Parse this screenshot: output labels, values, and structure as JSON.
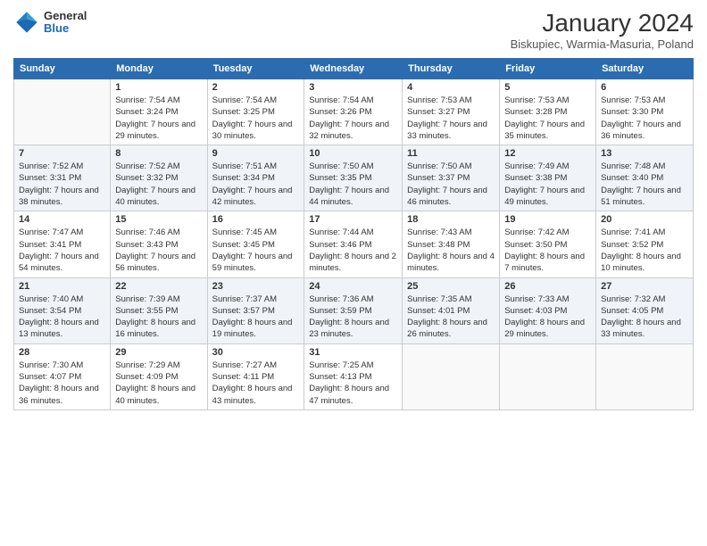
{
  "header": {
    "logo_general": "General",
    "logo_blue": "Blue",
    "title": "January 2024",
    "subtitle": "Biskupiec, Warmia-Masuria, Poland"
  },
  "weekdays": [
    "Sunday",
    "Monday",
    "Tuesday",
    "Wednesday",
    "Thursday",
    "Friday",
    "Saturday"
  ],
  "weeks": [
    [
      {
        "day": "",
        "sunrise": "",
        "sunset": "",
        "daylight": ""
      },
      {
        "day": "1",
        "sunrise": "Sunrise: 7:54 AM",
        "sunset": "Sunset: 3:24 PM",
        "daylight": "Daylight: 7 hours and 29 minutes."
      },
      {
        "day": "2",
        "sunrise": "Sunrise: 7:54 AM",
        "sunset": "Sunset: 3:25 PM",
        "daylight": "Daylight: 7 hours and 30 minutes."
      },
      {
        "day": "3",
        "sunrise": "Sunrise: 7:54 AM",
        "sunset": "Sunset: 3:26 PM",
        "daylight": "Daylight: 7 hours and 32 minutes."
      },
      {
        "day": "4",
        "sunrise": "Sunrise: 7:53 AM",
        "sunset": "Sunset: 3:27 PM",
        "daylight": "Daylight: 7 hours and 33 minutes."
      },
      {
        "day": "5",
        "sunrise": "Sunrise: 7:53 AM",
        "sunset": "Sunset: 3:28 PM",
        "daylight": "Daylight: 7 hours and 35 minutes."
      },
      {
        "day": "6",
        "sunrise": "Sunrise: 7:53 AM",
        "sunset": "Sunset: 3:30 PM",
        "daylight": "Daylight: 7 hours and 36 minutes."
      }
    ],
    [
      {
        "day": "7",
        "sunrise": "Sunrise: 7:52 AM",
        "sunset": "Sunset: 3:31 PM",
        "daylight": "Daylight: 7 hours and 38 minutes."
      },
      {
        "day": "8",
        "sunrise": "Sunrise: 7:52 AM",
        "sunset": "Sunset: 3:32 PM",
        "daylight": "Daylight: 7 hours and 40 minutes."
      },
      {
        "day": "9",
        "sunrise": "Sunrise: 7:51 AM",
        "sunset": "Sunset: 3:34 PM",
        "daylight": "Daylight: 7 hours and 42 minutes."
      },
      {
        "day": "10",
        "sunrise": "Sunrise: 7:50 AM",
        "sunset": "Sunset: 3:35 PM",
        "daylight": "Daylight: 7 hours and 44 minutes."
      },
      {
        "day": "11",
        "sunrise": "Sunrise: 7:50 AM",
        "sunset": "Sunset: 3:37 PM",
        "daylight": "Daylight: 7 hours and 46 minutes."
      },
      {
        "day": "12",
        "sunrise": "Sunrise: 7:49 AM",
        "sunset": "Sunset: 3:38 PM",
        "daylight": "Daylight: 7 hours and 49 minutes."
      },
      {
        "day": "13",
        "sunrise": "Sunrise: 7:48 AM",
        "sunset": "Sunset: 3:40 PM",
        "daylight": "Daylight: 7 hours and 51 minutes."
      }
    ],
    [
      {
        "day": "14",
        "sunrise": "Sunrise: 7:47 AM",
        "sunset": "Sunset: 3:41 PM",
        "daylight": "Daylight: 7 hours and 54 minutes."
      },
      {
        "day": "15",
        "sunrise": "Sunrise: 7:46 AM",
        "sunset": "Sunset: 3:43 PM",
        "daylight": "Daylight: 7 hours and 56 minutes."
      },
      {
        "day": "16",
        "sunrise": "Sunrise: 7:45 AM",
        "sunset": "Sunset: 3:45 PM",
        "daylight": "Daylight: 7 hours and 59 minutes."
      },
      {
        "day": "17",
        "sunrise": "Sunrise: 7:44 AM",
        "sunset": "Sunset: 3:46 PM",
        "daylight": "Daylight: 8 hours and 2 minutes."
      },
      {
        "day": "18",
        "sunrise": "Sunrise: 7:43 AM",
        "sunset": "Sunset: 3:48 PM",
        "daylight": "Daylight: 8 hours and 4 minutes."
      },
      {
        "day": "19",
        "sunrise": "Sunrise: 7:42 AM",
        "sunset": "Sunset: 3:50 PM",
        "daylight": "Daylight: 8 hours and 7 minutes."
      },
      {
        "day": "20",
        "sunrise": "Sunrise: 7:41 AM",
        "sunset": "Sunset: 3:52 PM",
        "daylight": "Daylight: 8 hours and 10 minutes."
      }
    ],
    [
      {
        "day": "21",
        "sunrise": "Sunrise: 7:40 AM",
        "sunset": "Sunset: 3:54 PM",
        "daylight": "Daylight: 8 hours and 13 minutes."
      },
      {
        "day": "22",
        "sunrise": "Sunrise: 7:39 AM",
        "sunset": "Sunset: 3:55 PM",
        "daylight": "Daylight: 8 hours and 16 minutes."
      },
      {
        "day": "23",
        "sunrise": "Sunrise: 7:37 AM",
        "sunset": "Sunset: 3:57 PM",
        "daylight": "Daylight: 8 hours and 19 minutes."
      },
      {
        "day": "24",
        "sunrise": "Sunrise: 7:36 AM",
        "sunset": "Sunset: 3:59 PM",
        "daylight": "Daylight: 8 hours and 23 minutes."
      },
      {
        "day": "25",
        "sunrise": "Sunrise: 7:35 AM",
        "sunset": "Sunset: 4:01 PM",
        "daylight": "Daylight: 8 hours and 26 minutes."
      },
      {
        "day": "26",
        "sunrise": "Sunrise: 7:33 AM",
        "sunset": "Sunset: 4:03 PM",
        "daylight": "Daylight: 8 hours and 29 minutes."
      },
      {
        "day": "27",
        "sunrise": "Sunrise: 7:32 AM",
        "sunset": "Sunset: 4:05 PM",
        "daylight": "Daylight: 8 hours and 33 minutes."
      }
    ],
    [
      {
        "day": "28",
        "sunrise": "Sunrise: 7:30 AM",
        "sunset": "Sunset: 4:07 PM",
        "daylight": "Daylight: 8 hours and 36 minutes."
      },
      {
        "day": "29",
        "sunrise": "Sunrise: 7:29 AM",
        "sunset": "Sunset: 4:09 PM",
        "daylight": "Daylight: 8 hours and 40 minutes."
      },
      {
        "day": "30",
        "sunrise": "Sunrise: 7:27 AM",
        "sunset": "Sunset: 4:11 PM",
        "daylight": "Daylight: 8 hours and 43 minutes."
      },
      {
        "day": "31",
        "sunrise": "Sunrise: 7:25 AM",
        "sunset": "Sunset: 4:13 PM",
        "daylight": "Daylight: 8 hours and 47 minutes."
      },
      {
        "day": "",
        "sunrise": "",
        "sunset": "",
        "daylight": ""
      },
      {
        "day": "",
        "sunrise": "",
        "sunset": "",
        "daylight": ""
      },
      {
        "day": "",
        "sunrise": "",
        "sunset": "",
        "daylight": ""
      }
    ]
  ]
}
